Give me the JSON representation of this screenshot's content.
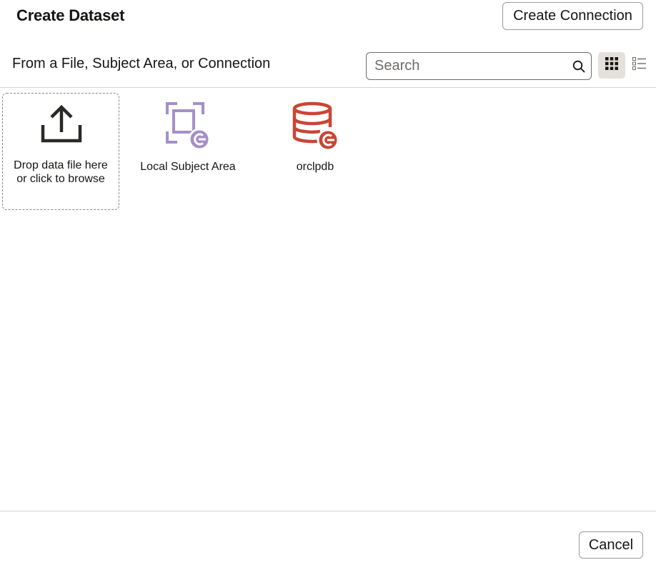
{
  "dialog": {
    "title": "Create Dataset",
    "create_connection_label": "Create Connection",
    "subtitle": "From a File, Subject Area, or Connection",
    "cancel_label": "Cancel"
  },
  "search": {
    "placeholder": "Search",
    "value": ""
  },
  "view_toggle": {
    "selected": "grid",
    "icons": [
      "grid-view-icon",
      "list-view-icon"
    ]
  },
  "drop_zone": {
    "label": "Drop data file here or click to browse",
    "icon": "upload-icon"
  },
  "tiles": [
    {
      "label": "Local Subject Area",
      "icon": "subject-area-icon",
      "color": "#a58fc8"
    },
    {
      "label": "orclpdb",
      "icon": "database-connection-icon",
      "color": "#c74634"
    }
  ],
  "colors": {
    "selected_toggle_bg": "#e4e1dd",
    "text": "#161513"
  }
}
